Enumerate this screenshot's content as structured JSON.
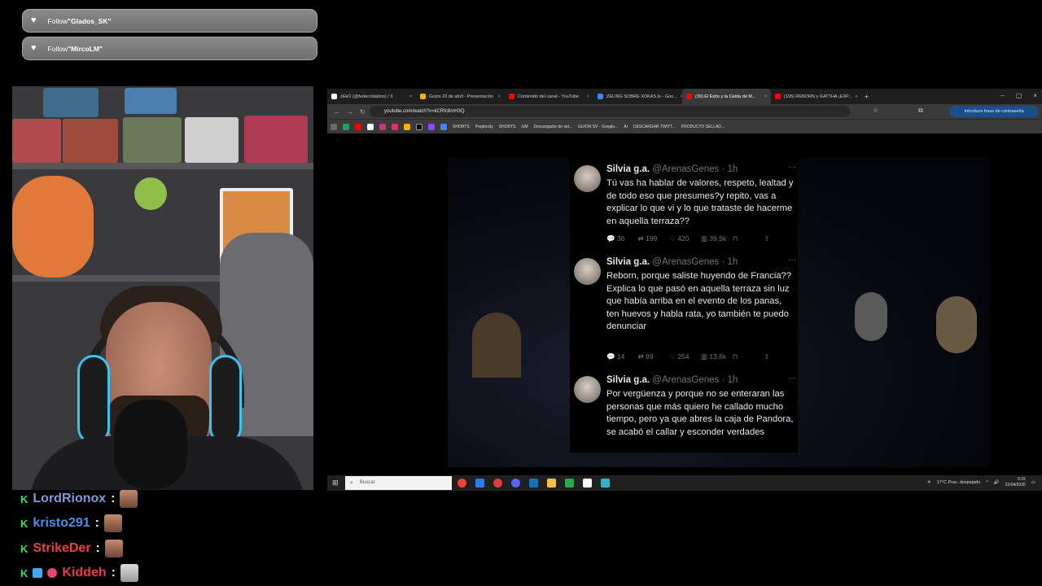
{
  "alerts": [
    {
      "prefix": "Follow ",
      "user": "\"Glados_SK\""
    },
    {
      "prefix": "Follow ",
      "user": "\"MircoLM\""
    }
  ],
  "chat": [
    {
      "badge": "K",
      "name": "LordRionox",
      "color": "#7e9ad6"
    },
    {
      "badge": "K",
      "name": "kristo291",
      "color": "#4f8de8"
    },
    {
      "badge": "K",
      "name": "StrikeDer",
      "color": "#e2453a"
    },
    {
      "badge": "K",
      "name": "Kiddeh",
      "color": "#e23a4b"
    }
  ],
  "chat_separator": ":",
  "browser": {
    "tabs": [
      {
        "label": "zEkO (@fedecristalino) / X",
        "color": "#ffffff",
        "active": false
      },
      {
        "label": "Guion 20 de abril - Presentación",
        "color": "#f4b400",
        "active": false
      },
      {
        "label": "Contenido del canal - YouTube",
        "color": "#ff0000",
        "active": false
      },
      {
        "label": "ZELING SOBRE XOKAS.ts - Goo...",
        "color": "#4285f4",
        "active": false
      },
      {
        "label": "(39) El Éxito y la Caída de M...",
        "color": "#ff0000",
        "active": true
      },
      {
        "label": "(195) REBORN y GATTHA ¡EXP...",
        "color": "#ff0000",
        "active": false
      }
    ],
    "tab_close": "×",
    "new_tab": "+",
    "window_controls": [
      "–",
      "▢",
      "×"
    ],
    "url": "youtube.com/watch?v=kCRfc8mH3Q",
    "password_prompt": "Introducir frase de contraseña",
    "bookmarks": [
      "SHORTS",
      "Perplexity",
      "SHORTS",
      "GM",
      "Descargador de vid...",
      "GUION SV - Google...",
      "AI",
      "DESCARGAR TWITT...",
      "PRODUCTO SELLAD..."
    ]
  },
  "tweets": [
    {
      "name": "Silvia g.a.",
      "handle": "@ArenasGenes · 1h",
      "body": "Tú vas ha hablar de valores, respeto, lealtad y de todo eso que presumes?y repito, vas a explicar lo que vi y lo que trataste de hacerme en aquella terraza??",
      "replies": "36",
      "retweets": "199",
      "likes": "420",
      "views": "39,9k"
    },
    {
      "name": "Silvia g.a.",
      "handle": "@ArenasGenes · 1h",
      "body": "Reborn, porque saliste huyendo de Francia??\nExplica lo que pasó en aquella terraza sin luz que había arriba en el evento de los panas, ten huevos y habla rata, yo también te puedo denunciar",
      "replies": "14",
      "retweets": "89",
      "likes": "254",
      "views": "13,8k"
    },
    {
      "name": "Silvia g.a.",
      "handle": "@ArenasGenes · 1h",
      "body": "Por vergüenza y porque no se enteraran las personas que más quiero he callado mucho tiempo, pero ya que abres la caja de Pandora, se acabó el callar y esconder verdades",
      "replies": "",
      "retweets": "",
      "likes": "",
      "views": ""
    }
  ],
  "taskbar": {
    "search_placeholder": "Buscar",
    "weather": "17°C  Prac. despejado",
    "time": "0:15",
    "date": "22/04/2026"
  }
}
